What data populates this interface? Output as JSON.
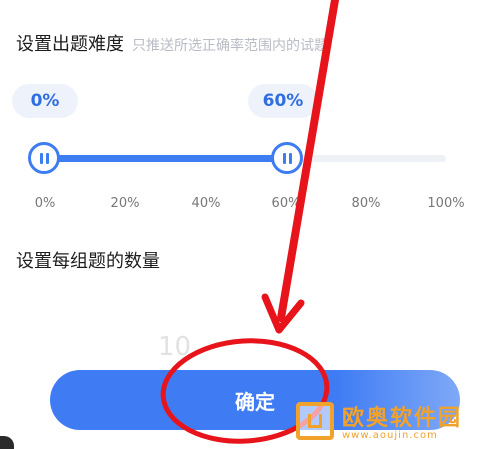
{
  "difficulty": {
    "title": "设置出题难度",
    "subtitle": "只推送所选正确率范围内的试题",
    "range_min_label": "0%",
    "range_max_label": "60%",
    "range_min_value": 0,
    "range_max_value": 60,
    "ticks": [
      "0%",
      "20%",
      "40%",
      "60%",
      "80%",
      "100%"
    ]
  },
  "count": {
    "title": "设置每组题的数量",
    "picker_value": "10"
  },
  "confirm_label": "确定",
  "colors": {
    "accent": "#3e7cf2",
    "annotation": "#e8141b",
    "watermark": "#f1a22b"
  },
  "watermark": {
    "cn": "欧奥软件园",
    "en": "www.aoujin.com"
  }
}
